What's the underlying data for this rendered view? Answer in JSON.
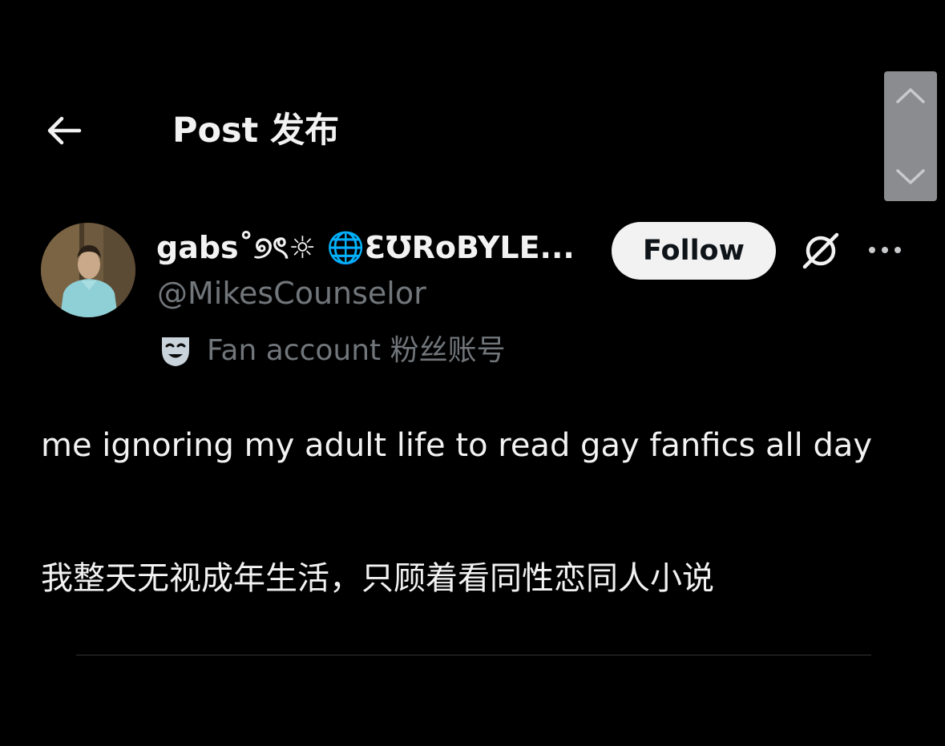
{
  "header": {
    "back_icon": "arrow-left-icon",
    "title": "Post 发布"
  },
  "scroll_control": {
    "up_icon": "chevron-up-icon",
    "down_icon": "chevron-down-icon"
  },
  "author": {
    "name": "gabs˚୭ৎ☼ 🌐ƐƱRoBYLE...",
    "handle": "@MikesCounselor",
    "follow_label": "Follow",
    "grok_icon": "grok-icon",
    "more_icon": "more-options-icon"
  },
  "label": {
    "icon": "theater-mask-icon",
    "text": "Fan account 粉丝账号"
  },
  "post": {
    "text": "me ignoring my adult life to read gay fanfics all day",
    "translation": "我整天无视成年生活，只顾着看同性恋同人小说"
  },
  "colors": {
    "background": "#000000",
    "primary_text": "#f2f2f2",
    "secondary_text": "#71767b",
    "follow_bg": "#f2f2f2",
    "divider": "#2f3336"
  }
}
